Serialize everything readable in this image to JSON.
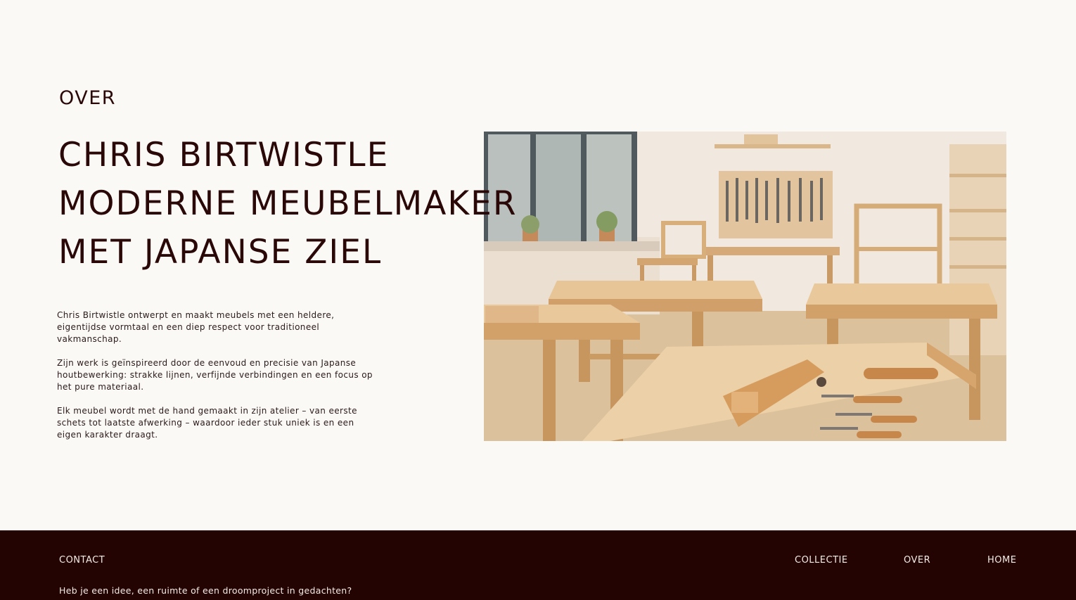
{
  "section": {
    "label": "OVER"
  },
  "hero": {
    "title_lines": [
      "CHRIS BIRTWISTLE",
      "MODERNE MEUBELMAKER",
      "MET JAPANSE ZIEL"
    ]
  },
  "intro": {
    "paragraphs": [
      "Chris Birtwistle ontwerpt en maakt meubels met een heldere, eigentijdse vormtaal en een diep respect voor traditioneel vakmanschap.",
      "Zijn werk is geïnspireerd door de eenvoud en precisie van Japanse houtbewerking: strakke lijnen, verfijnde verbindingen en een focus op het pure materiaal.",
      "Elk meubel wordt met de hand gemaakt in zijn atelier – van eerste schets tot laatste afwerking – waardoor ieder stuk uniek is en een eigen karakter draagt."
    ]
  },
  "footer": {
    "contact_label": "CONTACT",
    "contact_text": "Heb je een idee, een ruimte of een droomproject in gedachten?",
    "nav": [
      "COLLECTIE",
      "OVER",
      "HOME"
    ]
  },
  "colors": {
    "background": "#fbf9f5",
    "text": "#2a0808",
    "footer_bg": "#240303",
    "footer_text": "#f3ece6"
  }
}
